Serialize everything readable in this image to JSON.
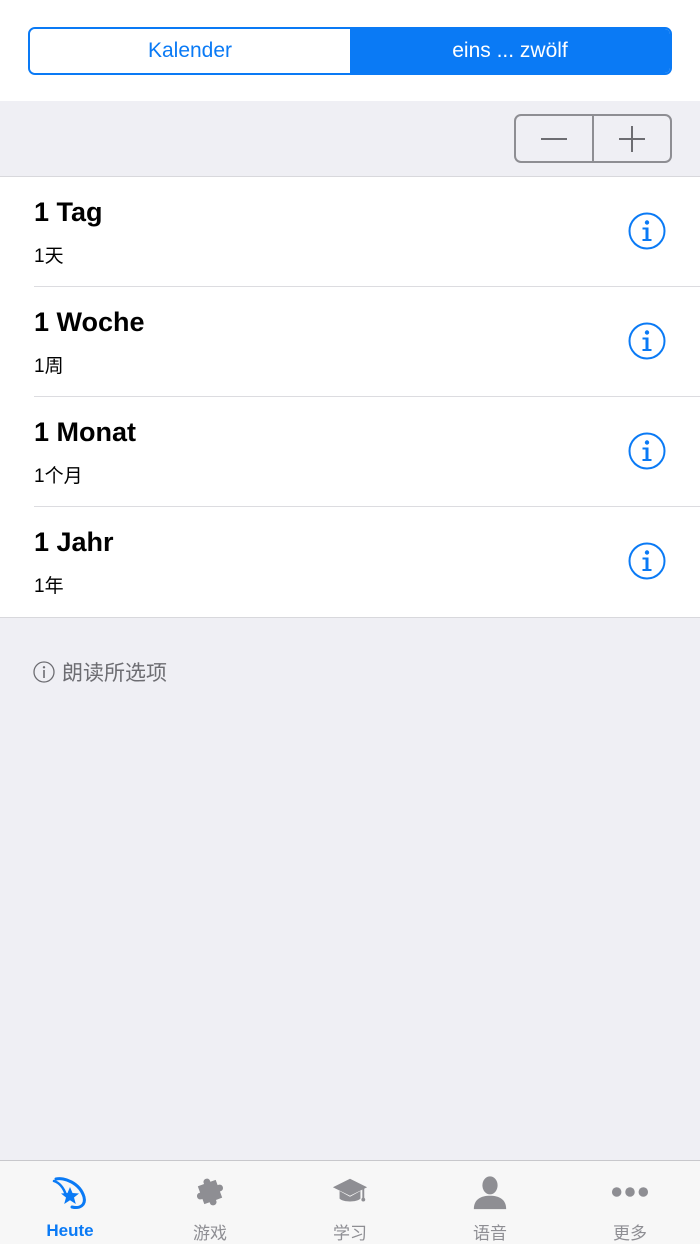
{
  "segmented": {
    "options": [
      {
        "label": "Kalender",
        "selected": false
      },
      {
        "label": "eins ... zwölf",
        "selected": true
      }
    ]
  },
  "stepper": {
    "minus": "−",
    "plus": "+"
  },
  "items": [
    {
      "title": "1 Tag",
      "subtitle": "1天"
    },
    {
      "title": "1 Woche",
      "subtitle": "1周"
    },
    {
      "title": "1 Monat",
      "subtitle": "1个月"
    },
    {
      "title": "1 Jahr",
      "subtitle": "1年"
    }
  ],
  "footer_note": "朗读所选项",
  "tabbar": {
    "tabs": [
      {
        "label": "Heute",
        "icon": "star-swoosh-icon",
        "active": true
      },
      {
        "label": "游戏",
        "icon": "puzzle-icon",
        "active": false
      },
      {
        "label": "学习",
        "icon": "graduation-cap-icon",
        "active": false
      },
      {
        "label": "语音",
        "icon": "person-icon",
        "active": false
      },
      {
        "label": "更多",
        "icon": "more-dots-icon",
        "active": false
      }
    ]
  },
  "colors": {
    "accent": "#0a7af5",
    "background": "#efeff4",
    "inactive": "#8e8e93"
  }
}
